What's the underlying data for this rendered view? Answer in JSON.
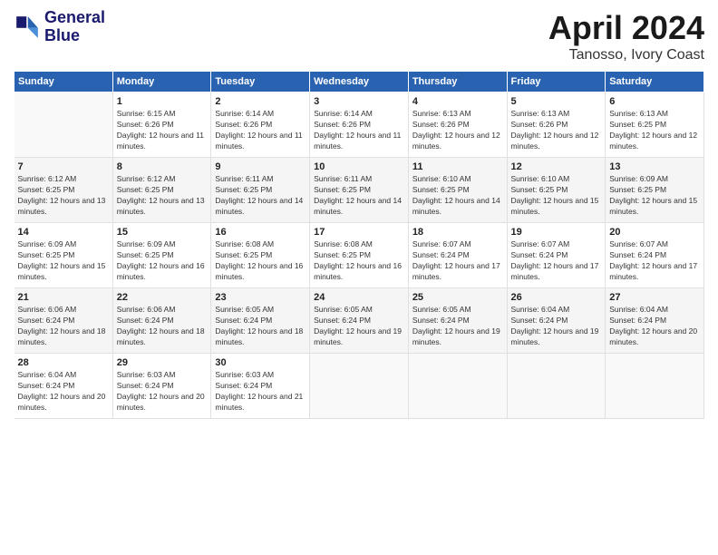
{
  "header": {
    "logo_line1": "General",
    "logo_line2": "Blue",
    "month": "April 2024",
    "location": "Tanosso, Ivory Coast"
  },
  "columns": [
    "Sunday",
    "Monday",
    "Tuesday",
    "Wednesday",
    "Thursday",
    "Friday",
    "Saturday"
  ],
  "weeks": [
    [
      {
        "day": "",
        "sunrise": "",
        "sunset": "",
        "daylight": ""
      },
      {
        "day": "1",
        "sunrise": "Sunrise: 6:15 AM",
        "sunset": "Sunset: 6:26 PM",
        "daylight": "Daylight: 12 hours and 11 minutes."
      },
      {
        "day": "2",
        "sunrise": "Sunrise: 6:14 AM",
        "sunset": "Sunset: 6:26 PM",
        "daylight": "Daylight: 12 hours and 11 minutes."
      },
      {
        "day": "3",
        "sunrise": "Sunrise: 6:14 AM",
        "sunset": "Sunset: 6:26 PM",
        "daylight": "Daylight: 12 hours and 11 minutes."
      },
      {
        "day": "4",
        "sunrise": "Sunrise: 6:13 AM",
        "sunset": "Sunset: 6:26 PM",
        "daylight": "Daylight: 12 hours and 12 minutes."
      },
      {
        "day": "5",
        "sunrise": "Sunrise: 6:13 AM",
        "sunset": "Sunset: 6:26 PM",
        "daylight": "Daylight: 12 hours and 12 minutes."
      },
      {
        "day": "6",
        "sunrise": "Sunrise: 6:13 AM",
        "sunset": "Sunset: 6:25 PM",
        "daylight": "Daylight: 12 hours and 12 minutes."
      }
    ],
    [
      {
        "day": "7",
        "sunrise": "Sunrise: 6:12 AM",
        "sunset": "Sunset: 6:25 PM",
        "daylight": "Daylight: 12 hours and 13 minutes."
      },
      {
        "day": "8",
        "sunrise": "Sunrise: 6:12 AM",
        "sunset": "Sunset: 6:25 PM",
        "daylight": "Daylight: 12 hours and 13 minutes."
      },
      {
        "day": "9",
        "sunrise": "Sunrise: 6:11 AM",
        "sunset": "Sunset: 6:25 PM",
        "daylight": "Daylight: 12 hours and 14 minutes."
      },
      {
        "day": "10",
        "sunrise": "Sunrise: 6:11 AM",
        "sunset": "Sunset: 6:25 PM",
        "daylight": "Daylight: 12 hours and 14 minutes."
      },
      {
        "day": "11",
        "sunrise": "Sunrise: 6:10 AM",
        "sunset": "Sunset: 6:25 PM",
        "daylight": "Daylight: 12 hours and 14 minutes."
      },
      {
        "day": "12",
        "sunrise": "Sunrise: 6:10 AM",
        "sunset": "Sunset: 6:25 PM",
        "daylight": "Daylight: 12 hours and 15 minutes."
      },
      {
        "day": "13",
        "sunrise": "Sunrise: 6:09 AM",
        "sunset": "Sunset: 6:25 PM",
        "daylight": "Daylight: 12 hours and 15 minutes."
      }
    ],
    [
      {
        "day": "14",
        "sunrise": "Sunrise: 6:09 AM",
        "sunset": "Sunset: 6:25 PM",
        "daylight": "Daylight: 12 hours and 15 minutes."
      },
      {
        "day": "15",
        "sunrise": "Sunrise: 6:09 AM",
        "sunset": "Sunset: 6:25 PM",
        "daylight": "Daylight: 12 hours and 16 minutes."
      },
      {
        "day": "16",
        "sunrise": "Sunrise: 6:08 AM",
        "sunset": "Sunset: 6:25 PM",
        "daylight": "Daylight: 12 hours and 16 minutes."
      },
      {
        "day": "17",
        "sunrise": "Sunrise: 6:08 AM",
        "sunset": "Sunset: 6:25 PM",
        "daylight": "Daylight: 12 hours and 16 minutes."
      },
      {
        "day": "18",
        "sunrise": "Sunrise: 6:07 AM",
        "sunset": "Sunset: 6:24 PM",
        "daylight": "Daylight: 12 hours and 17 minutes."
      },
      {
        "day": "19",
        "sunrise": "Sunrise: 6:07 AM",
        "sunset": "Sunset: 6:24 PM",
        "daylight": "Daylight: 12 hours and 17 minutes."
      },
      {
        "day": "20",
        "sunrise": "Sunrise: 6:07 AM",
        "sunset": "Sunset: 6:24 PM",
        "daylight": "Daylight: 12 hours and 17 minutes."
      }
    ],
    [
      {
        "day": "21",
        "sunrise": "Sunrise: 6:06 AM",
        "sunset": "Sunset: 6:24 PM",
        "daylight": "Daylight: 12 hours and 18 minutes."
      },
      {
        "day": "22",
        "sunrise": "Sunrise: 6:06 AM",
        "sunset": "Sunset: 6:24 PM",
        "daylight": "Daylight: 12 hours and 18 minutes."
      },
      {
        "day": "23",
        "sunrise": "Sunrise: 6:05 AM",
        "sunset": "Sunset: 6:24 PM",
        "daylight": "Daylight: 12 hours and 18 minutes."
      },
      {
        "day": "24",
        "sunrise": "Sunrise: 6:05 AM",
        "sunset": "Sunset: 6:24 PM",
        "daylight": "Daylight: 12 hours and 19 minutes."
      },
      {
        "day": "25",
        "sunrise": "Sunrise: 6:05 AM",
        "sunset": "Sunset: 6:24 PM",
        "daylight": "Daylight: 12 hours and 19 minutes."
      },
      {
        "day": "26",
        "sunrise": "Sunrise: 6:04 AM",
        "sunset": "Sunset: 6:24 PM",
        "daylight": "Daylight: 12 hours and 19 minutes."
      },
      {
        "day": "27",
        "sunrise": "Sunrise: 6:04 AM",
        "sunset": "Sunset: 6:24 PM",
        "daylight": "Daylight: 12 hours and 20 minutes."
      }
    ],
    [
      {
        "day": "28",
        "sunrise": "Sunrise: 6:04 AM",
        "sunset": "Sunset: 6:24 PM",
        "daylight": "Daylight: 12 hours and 20 minutes."
      },
      {
        "day": "29",
        "sunrise": "Sunrise: 6:03 AM",
        "sunset": "Sunset: 6:24 PM",
        "daylight": "Daylight: 12 hours and 20 minutes."
      },
      {
        "day": "30",
        "sunrise": "Sunrise: 6:03 AM",
        "sunset": "Sunset: 6:24 PM",
        "daylight": "Daylight: 12 hours and 21 minutes."
      },
      {
        "day": "",
        "sunrise": "",
        "sunset": "",
        "daylight": ""
      },
      {
        "day": "",
        "sunrise": "",
        "sunset": "",
        "daylight": ""
      },
      {
        "day": "",
        "sunrise": "",
        "sunset": "",
        "daylight": ""
      },
      {
        "day": "",
        "sunrise": "",
        "sunset": "",
        "daylight": ""
      }
    ]
  ]
}
